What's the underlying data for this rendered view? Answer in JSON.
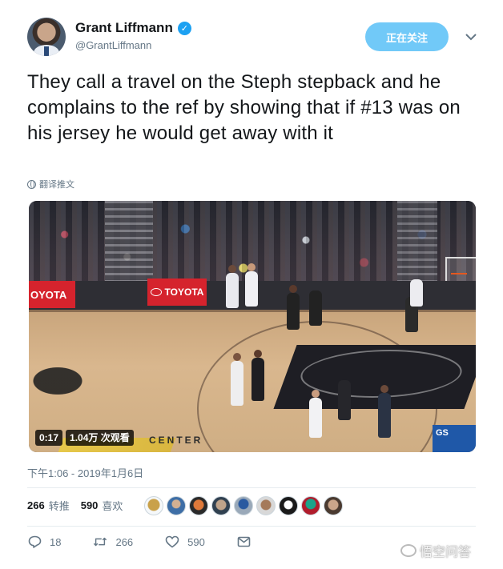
{
  "author": {
    "display_name": "Grant Liffmann",
    "handle": "@GrantLiffmann",
    "verified": true,
    "avatar_icon": "avatar-photo"
  },
  "follow_button_label": "正在关注",
  "menu_icon": "chevron-down-icon",
  "tweet": {
    "text": "They call a travel on the Steph stepback and he complains to the ref by showing that if #13 was on his jersey he would get away with it",
    "translate_label": "翻译推文"
  },
  "media": {
    "ad_left": "OYOTA",
    "ad_mid": "TOYOTA",
    "court_sign": "CENTER",
    "score_bug": "GS",
    "duration": "0:17",
    "views": "1.04万 次观看"
  },
  "timestamp": "下午1:06 - 2019年1月6日",
  "stats": {
    "retweets": "266",
    "retweets_label": "转推",
    "likes": "590",
    "likes_label": "喜欢"
  },
  "actions": {
    "reply_count": "18",
    "retweet_count": "266",
    "like_count": "590"
  },
  "watermark": "悟空问答",
  "colors": {
    "accent": "#1da1f2",
    "follow_bg": "#71c9f8",
    "muted": "#657786"
  }
}
